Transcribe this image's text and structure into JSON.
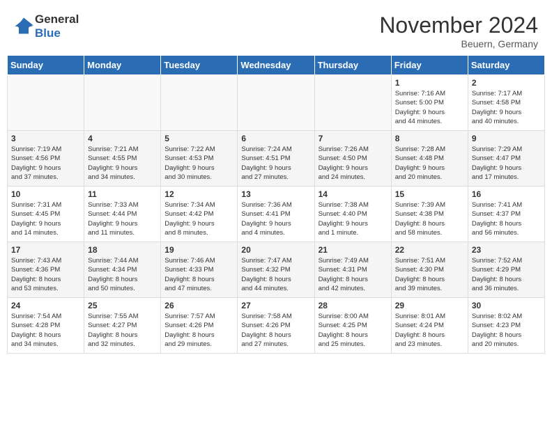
{
  "header": {
    "logo_line1": "General",
    "logo_line2": "Blue",
    "month": "November 2024",
    "location": "Beuern, Germany"
  },
  "weekdays": [
    "Sunday",
    "Monday",
    "Tuesday",
    "Wednesday",
    "Thursday",
    "Friday",
    "Saturday"
  ],
  "weeks": [
    [
      {
        "day": "",
        "info": ""
      },
      {
        "day": "",
        "info": ""
      },
      {
        "day": "",
        "info": ""
      },
      {
        "day": "",
        "info": ""
      },
      {
        "day": "",
        "info": ""
      },
      {
        "day": "1",
        "info": "Sunrise: 7:16 AM\nSunset: 5:00 PM\nDaylight: 9 hours\nand 44 minutes."
      },
      {
        "day": "2",
        "info": "Sunrise: 7:17 AM\nSunset: 4:58 PM\nDaylight: 9 hours\nand 40 minutes."
      }
    ],
    [
      {
        "day": "3",
        "info": "Sunrise: 7:19 AM\nSunset: 4:56 PM\nDaylight: 9 hours\nand 37 minutes."
      },
      {
        "day": "4",
        "info": "Sunrise: 7:21 AM\nSunset: 4:55 PM\nDaylight: 9 hours\nand 34 minutes."
      },
      {
        "day": "5",
        "info": "Sunrise: 7:22 AM\nSunset: 4:53 PM\nDaylight: 9 hours\nand 30 minutes."
      },
      {
        "day": "6",
        "info": "Sunrise: 7:24 AM\nSunset: 4:51 PM\nDaylight: 9 hours\nand 27 minutes."
      },
      {
        "day": "7",
        "info": "Sunrise: 7:26 AM\nSunset: 4:50 PM\nDaylight: 9 hours\nand 24 minutes."
      },
      {
        "day": "8",
        "info": "Sunrise: 7:28 AM\nSunset: 4:48 PM\nDaylight: 9 hours\nand 20 minutes."
      },
      {
        "day": "9",
        "info": "Sunrise: 7:29 AM\nSunset: 4:47 PM\nDaylight: 9 hours\nand 17 minutes."
      }
    ],
    [
      {
        "day": "10",
        "info": "Sunrise: 7:31 AM\nSunset: 4:45 PM\nDaylight: 9 hours\nand 14 minutes."
      },
      {
        "day": "11",
        "info": "Sunrise: 7:33 AM\nSunset: 4:44 PM\nDaylight: 9 hours\nand 11 minutes."
      },
      {
        "day": "12",
        "info": "Sunrise: 7:34 AM\nSunset: 4:42 PM\nDaylight: 9 hours\nand 8 minutes."
      },
      {
        "day": "13",
        "info": "Sunrise: 7:36 AM\nSunset: 4:41 PM\nDaylight: 9 hours\nand 4 minutes."
      },
      {
        "day": "14",
        "info": "Sunrise: 7:38 AM\nSunset: 4:40 PM\nDaylight: 9 hours\nand 1 minute."
      },
      {
        "day": "15",
        "info": "Sunrise: 7:39 AM\nSunset: 4:38 PM\nDaylight: 8 hours\nand 58 minutes."
      },
      {
        "day": "16",
        "info": "Sunrise: 7:41 AM\nSunset: 4:37 PM\nDaylight: 8 hours\nand 56 minutes."
      }
    ],
    [
      {
        "day": "17",
        "info": "Sunrise: 7:43 AM\nSunset: 4:36 PM\nDaylight: 8 hours\nand 53 minutes."
      },
      {
        "day": "18",
        "info": "Sunrise: 7:44 AM\nSunset: 4:34 PM\nDaylight: 8 hours\nand 50 minutes."
      },
      {
        "day": "19",
        "info": "Sunrise: 7:46 AM\nSunset: 4:33 PM\nDaylight: 8 hours\nand 47 minutes."
      },
      {
        "day": "20",
        "info": "Sunrise: 7:47 AM\nSunset: 4:32 PM\nDaylight: 8 hours\nand 44 minutes."
      },
      {
        "day": "21",
        "info": "Sunrise: 7:49 AM\nSunset: 4:31 PM\nDaylight: 8 hours\nand 42 minutes."
      },
      {
        "day": "22",
        "info": "Sunrise: 7:51 AM\nSunset: 4:30 PM\nDaylight: 8 hours\nand 39 minutes."
      },
      {
        "day": "23",
        "info": "Sunrise: 7:52 AM\nSunset: 4:29 PM\nDaylight: 8 hours\nand 36 minutes."
      }
    ],
    [
      {
        "day": "24",
        "info": "Sunrise: 7:54 AM\nSunset: 4:28 PM\nDaylight: 8 hours\nand 34 minutes."
      },
      {
        "day": "25",
        "info": "Sunrise: 7:55 AM\nSunset: 4:27 PM\nDaylight: 8 hours\nand 32 minutes."
      },
      {
        "day": "26",
        "info": "Sunrise: 7:57 AM\nSunset: 4:26 PM\nDaylight: 8 hours\nand 29 minutes."
      },
      {
        "day": "27",
        "info": "Sunrise: 7:58 AM\nSunset: 4:26 PM\nDaylight: 8 hours\nand 27 minutes."
      },
      {
        "day": "28",
        "info": "Sunrise: 8:00 AM\nSunset: 4:25 PM\nDaylight: 8 hours\nand 25 minutes."
      },
      {
        "day": "29",
        "info": "Sunrise: 8:01 AM\nSunset: 4:24 PM\nDaylight: 8 hours\nand 23 minutes."
      },
      {
        "day": "30",
        "info": "Sunrise: 8:02 AM\nSunset: 4:23 PM\nDaylight: 8 hours\nand 20 minutes."
      }
    ]
  ]
}
